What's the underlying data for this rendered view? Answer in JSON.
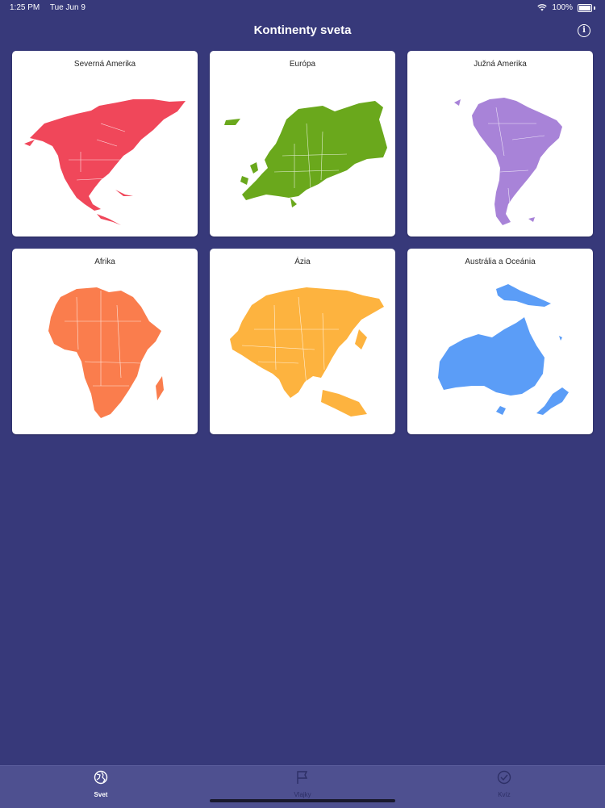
{
  "status_bar": {
    "time": "1:25 PM",
    "date": "Tue Jun 9",
    "battery": "100%"
  },
  "header": {
    "title": "Kontinenty sveta",
    "info_icon": "info-icon"
  },
  "continents": [
    {
      "label": "Severná Amerika",
      "color": "#f0475a"
    },
    {
      "label": "Európa",
      "color": "#6aa81c"
    },
    {
      "label": "Južná Amerika",
      "color": "#a883d8"
    },
    {
      "label": "Afrika",
      "color": "#fa7d4d"
    },
    {
      "label": "Ázia",
      "color": "#fdb33f"
    },
    {
      "label": "Austrália a Oceánia",
      "color": "#5b9df7"
    }
  ],
  "tabs": [
    {
      "label": "Svet",
      "icon": "globe-icon",
      "active": true
    },
    {
      "label": "Vlajky",
      "icon": "flag-icon",
      "active": false
    },
    {
      "label": "Kvíz",
      "icon": "check-circle-icon",
      "active": false
    }
  ],
  "colors": {
    "background": "#37397a",
    "tab_bar": "#4e5090"
  }
}
